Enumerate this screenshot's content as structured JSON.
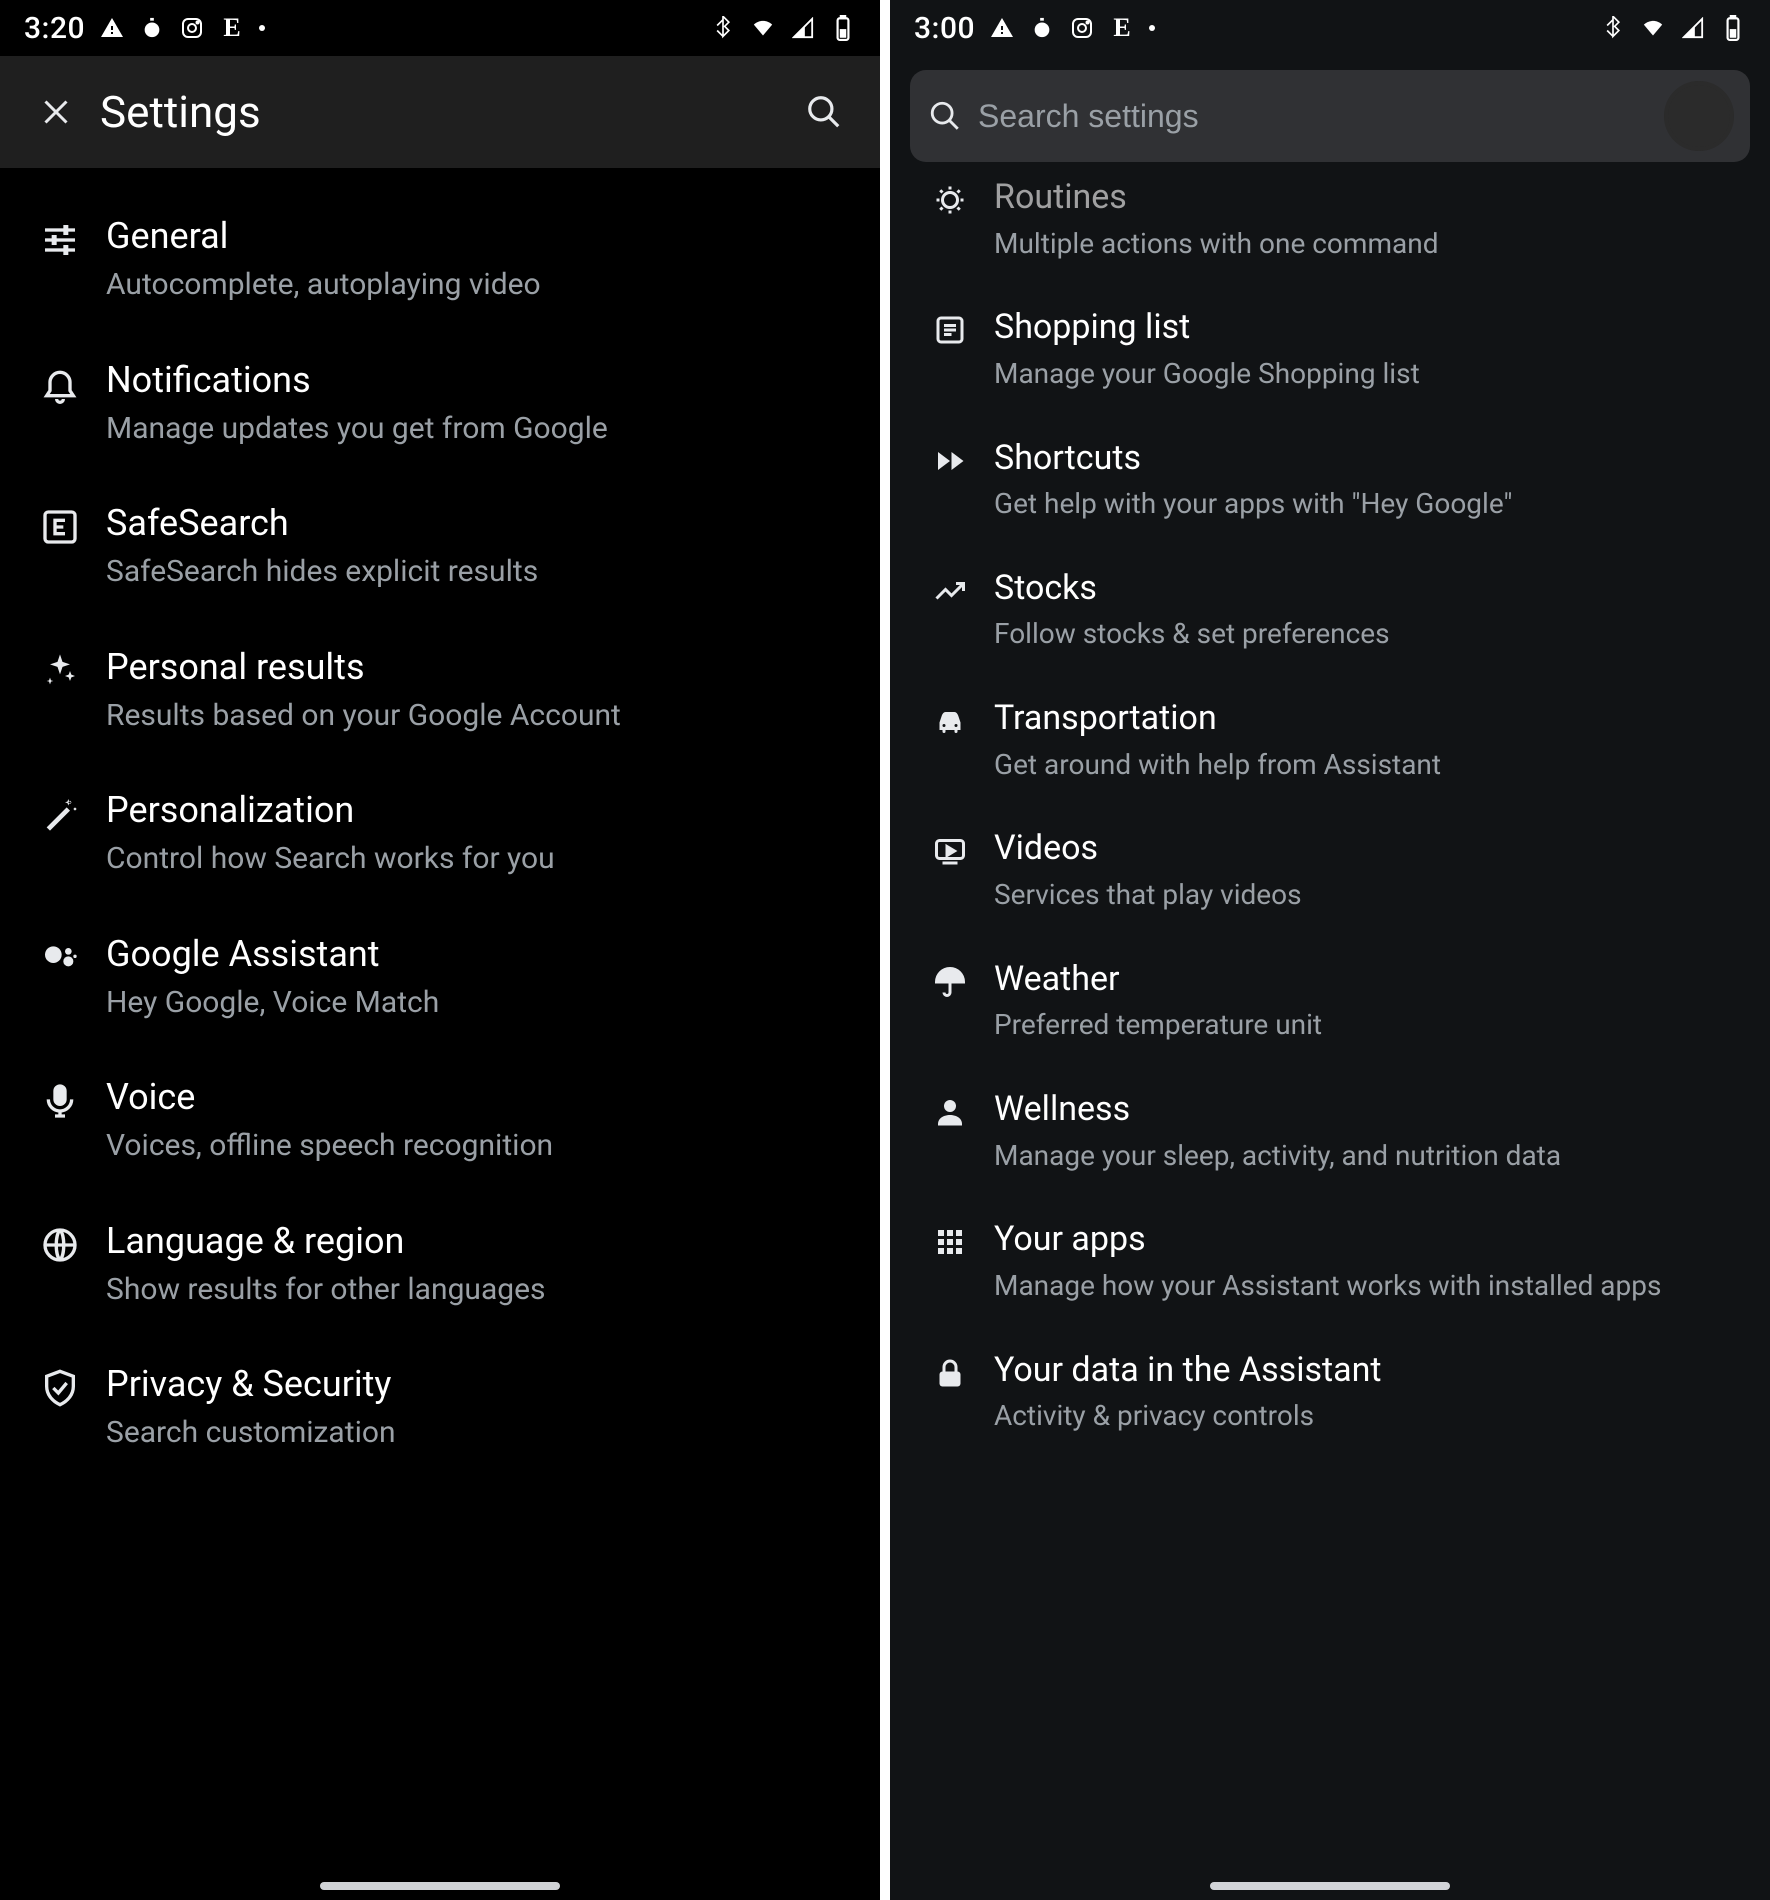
{
  "left": {
    "status": {
      "time": "3:20"
    },
    "appbar": {
      "title": "Settings"
    },
    "items": [
      {
        "title": "General",
        "subtitle": "Autocomplete, autoplaying video"
      },
      {
        "title": "Notifications",
        "subtitle": "Manage updates you get from Google"
      },
      {
        "title": "SafeSearch",
        "subtitle": "SafeSearch hides explicit results"
      },
      {
        "title": "Personal results",
        "subtitle": "Results based on your Google Account"
      },
      {
        "title": "Personalization",
        "subtitle": "Control how Search works for you"
      },
      {
        "title": "Google Assistant",
        "subtitle": "Hey Google, Voice Match"
      },
      {
        "title": "Voice",
        "subtitle": "Voices, offline speech recognition"
      },
      {
        "title": "Language & region",
        "subtitle": "Show results for other languages"
      },
      {
        "title": "Privacy & Security",
        "subtitle": "Search customization"
      }
    ]
  },
  "right": {
    "status": {
      "time": "3:00"
    },
    "search": {
      "placeholder": "Search settings"
    },
    "items": [
      {
        "title": "Routines",
        "subtitle": "Multiple actions with one command"
      },
      {
        "title": "Shopping list",
        "subtitle": "Manage your Google Shopping list"
      },
      {
        "title": "Shortcuts",
        "subtitle": "Get help with your apps with \"Hey Google\""
      },
      {
        "title": "Stocks",
        "subtitle": "Follow stocks & set preferences"
      },
      {
        "title": "Transportation",
        "subtitle": "Get around with help from Assistant"
      },
      {
        "title": "Videos",
        "subtitle": "Services that play videos"
      },
      {
        "title": "Weather",
        "subtitle": "Preferred temperature unit"
      },
      {
        "title": "Wellness",
        "subtitle": "Manage your sleep, activity, and nutrition data"
      },
      {
        "title": "Your apps",
        "subtitle": "Manage how your Assistant works with installed apps"
      },
      {
        "title": "Your data in the Assistant",
        "subtitle": "Activity & privacy controls"
      }
    ]
  }
}
